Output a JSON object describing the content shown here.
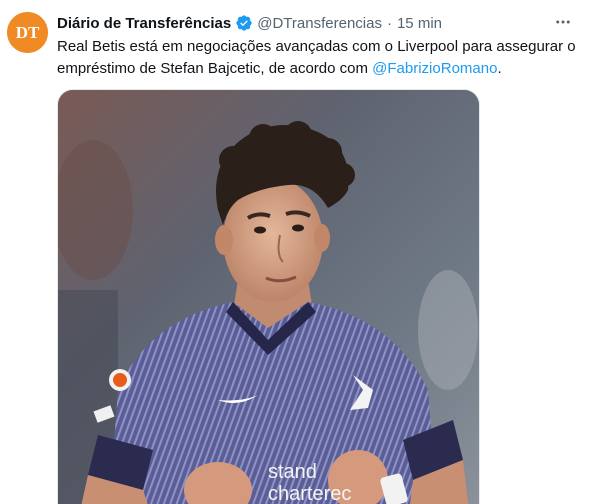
{
  "tweet": {
    "display_name": "Diário de Transferências",
    "handle": "@DTransferencias",
    "separator": "·",
    "time": "15 min",
    "text_before": "Real Betis está em negociações avançadas com o Liverpool para assegurar o empréstimo de Stefan Bajcetic, de acordo com ",
    "mention": "@FabrizioRomano",
    "text_after": "."
  },
  "avatar": {
    "initials": "DT",
    "color": "#f08a24"
  },
  "icons": {
    "verified": "verified-badge-icon",
    "more": "more-horizontal-icon"
  },
  "media": {
    "shirt_text_1": "stand",
    "shirt_text_2": "charterec"
  },
  "colors": {
    "accent": "#1d9bf0",
    "secondary_text": "#536471"
  }
}
